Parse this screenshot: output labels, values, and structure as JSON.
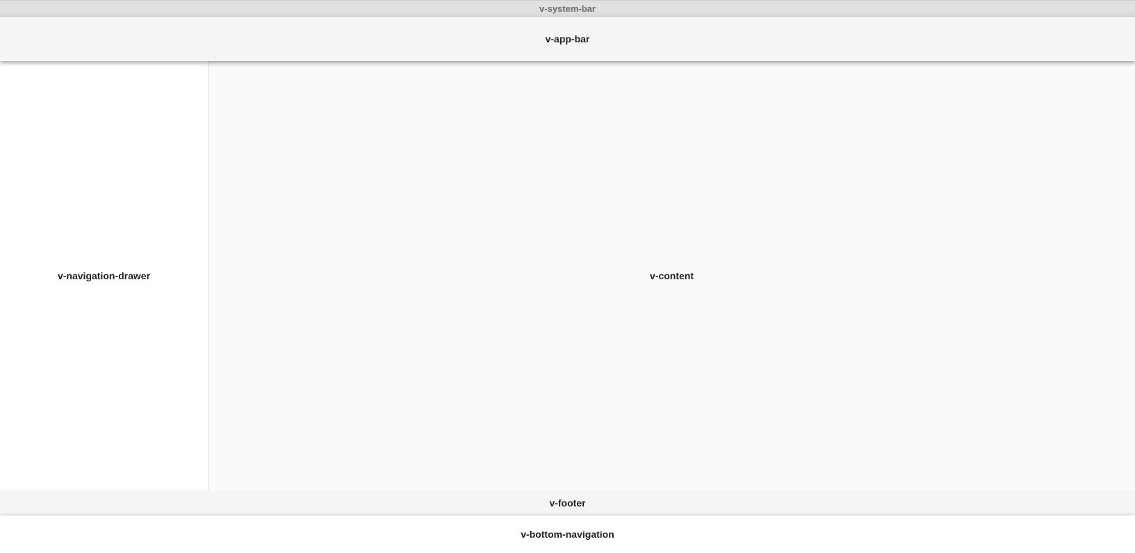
{
  "system_bar": {
    "label": "v-system-bar"
  },
  "app_bar": {
    "label": "v-app-bar"
  },
  "navigation_drawer": {
    "label": "v-navigation-drawer"
  },
  "content": {
    "label": "v-content"
  },
  "footer": {
    "label": "v-footer"
  },
  "bottom_navigation": {
    "label": "v-bottom-navigation"
  },
  "colors": {
    "system_bar": "#e0e0e0",
    "app_bar": "#f5f5f5",
    "navigation_drawer": "#ffffff",
    "content": "#fafafa",
    "footer": "#f5f5f5",
    "bottom_navigation": "#ffffff"
  }
}
